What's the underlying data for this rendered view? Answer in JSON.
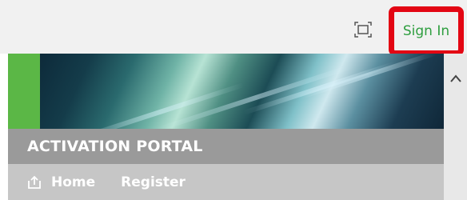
{
  "header": {
    "fullscreen_icon": "fullscreen-icon",
    "sign_in_label": "Sign In",
    "highlight_color": "#e30613",
    "sign_in_color": "#2e9e3f"
  },
  "banner": {
    "accent_color": "#5bb746"
  },
  "portal": {
    "title": "ACTIVATION PORTAL"
  },
  "nav": {
    "items": [
      {
        "label": "Home",
        "icon": "home-upload-icon"
      },
      {
        "label": "Register"
      }
    ]
  },
  "scrollbar": {
    "up_icon": "chevron-up-icon"
  }
}
